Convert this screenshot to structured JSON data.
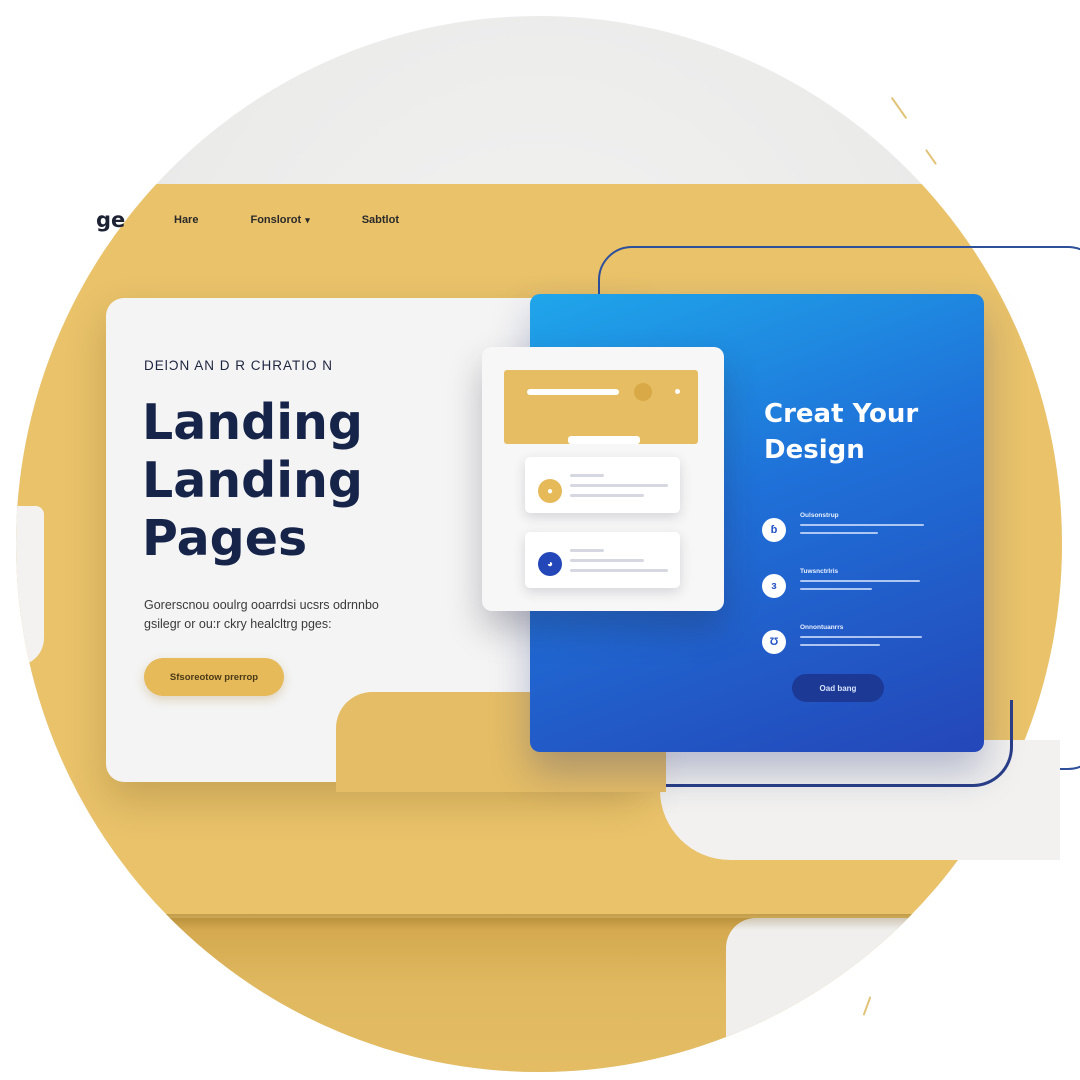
{
  "nav": {
    "logo": "ge",
    "links": [
      {
        "label": "Hare"
      },
      {
        "label": "Fonslorot",
        "has_dropdown": true
      },
      {
        "label": "Sabtlot"
      }
    ],
    "chevron": "▾"
  },
  "hero": {
    "eyebrow": "DEƖƆN AN D R CHRATIO N",
    "title_lines": [
      "Landing",
      "Landing",
      "Pages"
    ],
    "subtitle_lines": [
      "Gorerscnou ooulrg ooarrdsi ucsrs odrnnbo",
      "gsilegr or ou:r ckry healcltrg pges:"
    ],
    "cta_label": "Sfsoreotow prerrop"
  },
  "panel": {
    "title_lines": [
      "Creat Your",
      "Design"
    ],
    "features": [
      {
        "icon": "ɓ",
        "icon_name": "feature-one-icon",
        "title": "Oulsonstrup"
      },
      {
        "icon": "ɜ",
        "icon_name": "feature-two-icon",
        "title": "Tuwsnctrlris"
      },
      {
        "icon": "Ʊ",
        "icon_name": "feature-three-icon",
        "title": "Onnontuanrrs"
      }
    ],
    "button_label": "Oad bang"
  },
  "mockup": {
    "item_icons": [
      "●",
      "◕"
    ]
  },
  "colors": {
    "gold": "#e9c26a",
    "navy_text": "#16244a",
    "blue_start": "#1fa6ea",
    "blue_end": "#2446b8",
    "cta_gold": "#e6b959"
  }
}
